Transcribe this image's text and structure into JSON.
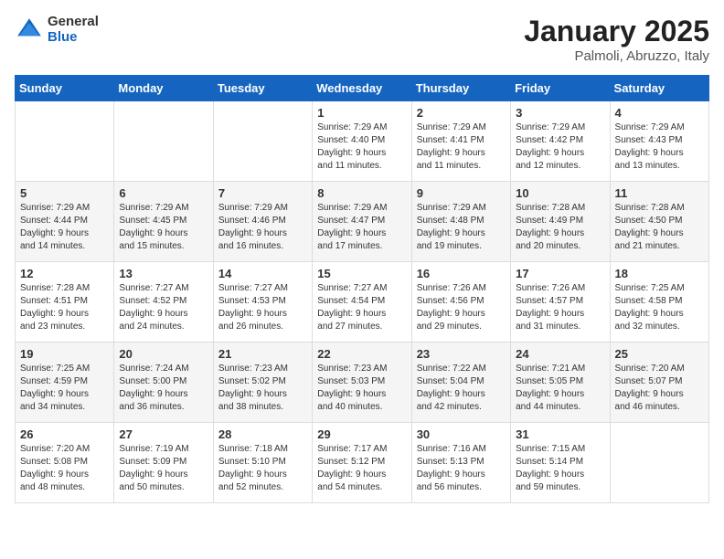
{
  "header": {
    "logo_general": "General",
    "logo_blue": "Blue",
    "title": "January 2025",
    "location": "Palmoli, Abruzzo, Italy"
  },
  "weekdays": [
    "Sunday",
    "Monday",
    "Tuesday",
    "Wednesday",
    "Thursday",
    "Friday",
    "Saturday"
  ],
  "weeks": [
    [
      {
        "day": "",
        "info": ""
      },
      {
        "day": "",
        "info": ""
      },
      {
        "day": "",
        "info": ""
      },
      {
        "day": "1",
        "info": "Sunrise: 7:29 AM\nSunset: 4:40 PM\nDaylight: 9 hours\nand 11 minutes."
      },
      {
        "day": "2",
        "info": "Sunrise: 7:29 AM\nSunset: 4:41 PM\nDaylight: 9 hours\nand 11 minutes."
      },
      {
        "day": "3",
        "info": "Sunrise: 7:29 AM\nSunset: 4:42 PM\nDaylight: 9 hours\nand 12 minutes."
      },
      {
        "day": "4",
        "info": "Sunrise: 7:29 AM\nSunset: 4:43 PM\nDaylight: 9 hours\nand 13 minutes."
      }
    ],
    [
      {
        "day": "5",
        "info": "Sunrise: 7:29 AM\nSunset: 4:44 PM\nDaylight: 9 hours\nand 14 minutes."
      },
      {
        "day": "6",
        "info": "Sunrise: 7:29 AM\nSunset: 4:45 PM\nDaylight: 9 hours\nand 15 minutes."
      },
      {
        "day": "7",
        "info": "Sunrise: 7:29 AM\nSunset: 4:46 PM\nDaylight: 9 hours\nand 16 minutes."
      },
      {
        "day": "8",
        "info": "Sunrise: 7:29 AM\nSunset: 4:47 PM\nDaylight: 9 hours\nand 17 minutes."
      },
      {
        "day": "9",
        "info": "Sunrise: 7:29 AM\nSunset: 4:48 PM\nDaylight: 9 hours\nand 19 minutes."
      },
      {
        "day": "10",
        "info": "Sunrise: 7:28 AM\nSunset: 4:49 PM\nDaylight: 9 hours\nand 20 minutes."
      },
      {
        "day": "11",
        "info": "Sunrise: 7:28 AM\nSunset: 4:50 PM\nDaylight: 9 hours\nand 21 minutes."
      }
    ],
    [
      {
        "day": "12",
        "info": "Sunrise: 7:28 AM\nSunset: 4:51 PM\nDaylight: 9 hours\nand 23 minutes."
      },
      {
        "day": "13",
        "info": "Sunrise: 7:27 AM\nSunset: 4:52 PM\nDaylight: 9 hours\nand 24 minutes."
      },
      {
        "day": "14",
        "info": "Sunrise: 7:27 AM\nSunset: 4:53 PM\nDaylight: 9 hours\nand 26 minutes."
      },
      {
        "day": "15",
        "info": "Sunrise: 7:27 AM\nSunset: 4:54 PM\nDaylight: 9 hours\nand 27 minutes."
      },
      {
        "day": "16",
        "info": "Sunrise: 7:26 AM\nSunset: 4:56 PM\nDaylight: 9 hours\nand 29 minutes."
      },
      {
        "day": "17",
        "info": "Sunrise: 7:26 AM\nSunset: 4:57 PM\nDaylight: 9 hours\nand 31 minutes."
      },
      {
        "day": "18",
        "info": "Sunrise: 7:25 AM\nSunset: 4:58 PM\nDaylight: 9 hours\nand 32 minutes."
      }
    ],
    [
      {
        "day": "19",
        "info": "Sunrise: 7:25 AM\nSunset: 4:59 PM\nDaylight: 9 hours\nand 34 minutes."
      },
      {
        "day": "20",
        "info": "Sunrise: 7:24 AM\nSunset: 5:00 PM\nDaylight: 9 hours\nand 36 minutes."
      },
      {
        "day": "21",
        "info": "Sunrise: 7:23 AM\nSunset: 5:02 PM\nDaylight: 9 hours\nand 38 minutes."
      },
      {
        "day": "22",
        "info": "Sunrise: 7:23 AM\nSunset: 5:03 PM\nDaylight: 9 hours\nand 40 minutes."
      },
      {
        "day": "23",
        "info": "Sunrise: 7:22 AM\nSunset: 5:04 PM\nDaylight: 9 hours\nand 42 minutes."
      },
      {
        "day": "24",
        "info": "Sunrise: 7:21 AM\nSunset: 5:05 PM\nDaylight: 9 hours\nand 44 minutes."
      },
      {
        "day": "25",
        "info": "Sunrise: 7:20 AM\nSunset: 5:07 PM\nDaylight: 9 hours\nand 46 minutes."
      }
    ],
    [
      {
        "day": "26",
        "info": "Sunrise: 7:20 AM\nSunset: 5:08 PM\nDaylight: 9 hours\nand 48 minutes."
      },
      {
        "day": "27",
        "info": "Sunrise: 7:19 AM\nSunset: 5:09 PM\nDaylight: 9 hours\nand 50 minutes."
      },
      {
        "day": "28",
        "info": "Sunrise: 7:18 AM\nSunset: 5:10 PM\nDaylight: 9 hours\nand 52 minutes."
      },
      {
        "day": "29",
        "info": "Sunrise: 7:17 AM\nSunset: 5:12 PM\nDaylight: 9 hours\nand 54 minutes."
      },
      {
        "day": "30",
        "info": "Sunrise: 7:16 AM\nSunset: 5:13 PM\nDaylight: 9 hours\nand 56 minutes."
      },
      {
        "day": "31",
        "info": "Sunrise: 7:15 AM\nSunset: 5:14 PM\nDaylight: 9 hours\nand 59 minutes."
      },
      {
        "day": "",
        "info": ""
      }
    ]
  ]
}
